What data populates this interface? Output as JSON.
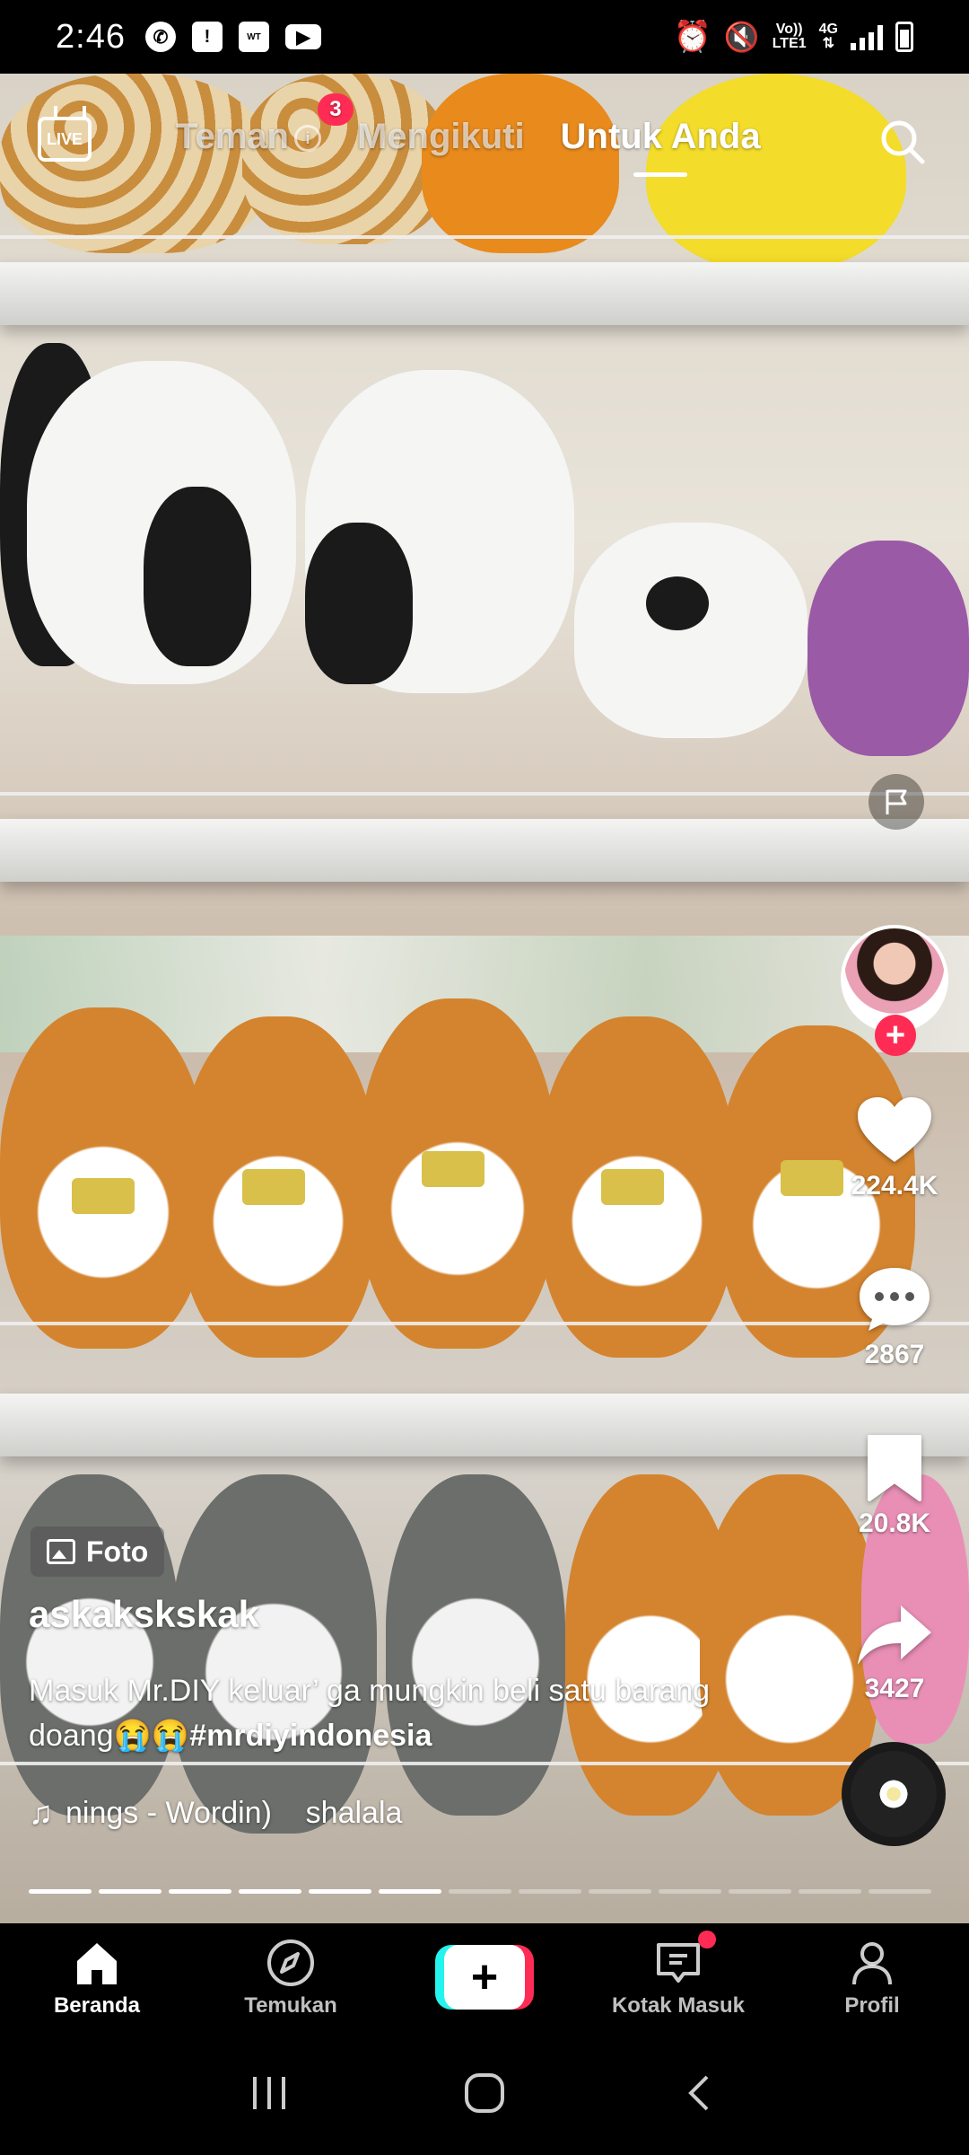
{
  "status_bar": {
    "time": "2:46",
    "network_top": "Vo))",
    "network_bottom": "LTE1",
    "network_type": "4G"
  },
  "top_nav": {
    "live_label": "LIVE",
    "tabs": [
      {
        "label": "Teman",
        "badge": "3"
      },
      {
        "label": "Mengikuti"
      },
      {
        "label": "Untuk Anda",
        "active": true
      }
    ]
  },
  "post": {
    "type_badge": "Foto",
    "username": "askakskskak",
    "caption_text": "Masuk Mr.DIY keluar’ ga mungkin beli satu barang doang😭😭",
    "caption_hashtag": "#mrdiyindonesia",
    "sound": "nings - Wordin)    shalala",
    "photo_count": 13,
    "photo_current": 6
  },
  "actions": {
    "likes": "224.4K",
    "comments": "2867",
    "saves": "20.8K",
    "shares": "3427"
  },
  "bottom_nav": {
    "items": [
      {
        "label": "Beranda",
        "icon": "home-icon",
        "active": true
      },
      {
        "label": "Temukan",
        "icon": "compass-icon"
      },
      {
        "label": "",
        "icon": "plus-icon"
      },
      {
        "label": "Kotak Masuk",
        "icon": "inbox-icon"
      },
      {
        "label": "Profil",
        "icon": "profile-icon"
      }
    ]
  },
  "colors": {
    "accent_red": "#fe2c55",
    "accent_cyan": "#25f4ee"
  }
}
